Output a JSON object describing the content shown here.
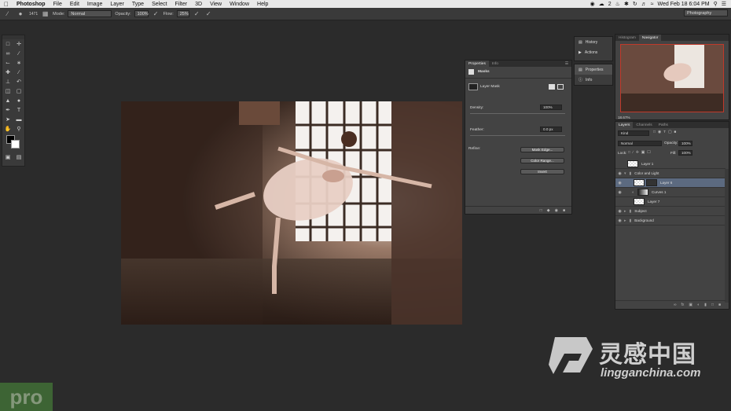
{
  "menubar": {
    "app_name": "Photoshop",
    "items": [
      "File",
      "Edit",
      "Image",
      "Layer",
      "Type",
      "Select",
      "Filter",
      "3D",
      "View",
      "Window",
      "Help"
    ],
    "clock": "Wed Feb 18  6:04 PM",
    "notification_count": "2"
  },
  "options": {
    "brush_size": "1471",
    "mode_label": "Mode:",
    "mode_value": "Normal",
    "opacity_label": "Opacity:",
    "opacity_value": "100%",
    "flow_label": "Flow:",
    "flow_value": "25%",
    "workspace": "Photography"
  },
  "properties": {
    "tabs": [
      "Properties",
      "Info"
    ],
    "section": "Masks",
    "mask_type": "Layer Mask",
    "density_label": "Density:",
    "density_value": "100%",
    "feather_label": "Feather:",
    "feather_value": "0.0 px",
    "refine_label": "Refine:",
    "buttons": [
      "Mask Edge...",
      "Color Range...",
      "Invert"
    ]
  },
  "dock": {
    "items": [
      "History",
      "Actions"
    ],
    "items2": [
      "Properties",
      "Info"
    ]
  },
  "navigator": {
    "tabs": [
      "Histogram",
      "Navigator"
    ],
    "zoom": "18.67%"
  },
  "layers": {
    "tabs": [
      "Layers",
      "Channels",
      "Paths"
    ],
    "kind": "Kind",
    "blend": "Normal",
    "opacity_label": "Opacity:",
    "opacity_value": "100%",
    "lock_label": "Lock:",
    "fill_label": "Fill:",
    "fill_value": "100%",
    "rows": [
      {
        "name": "Layer 1"
      },
      {
        "name": "Color and Light"
      },
      {
        "name": "Layer 6"
      },
      {
        "name": "Curves 1"
      },
      {
        "name": "Layer 7"
      },
      {
        "name": "Subject"
      },
      {
        "name": "Background"
      }
    ]
  },
  "watermark": {
    "cn": "灵感中国",
    "en": "lingganchina.com",
    "badge": "pro"
  }
}
